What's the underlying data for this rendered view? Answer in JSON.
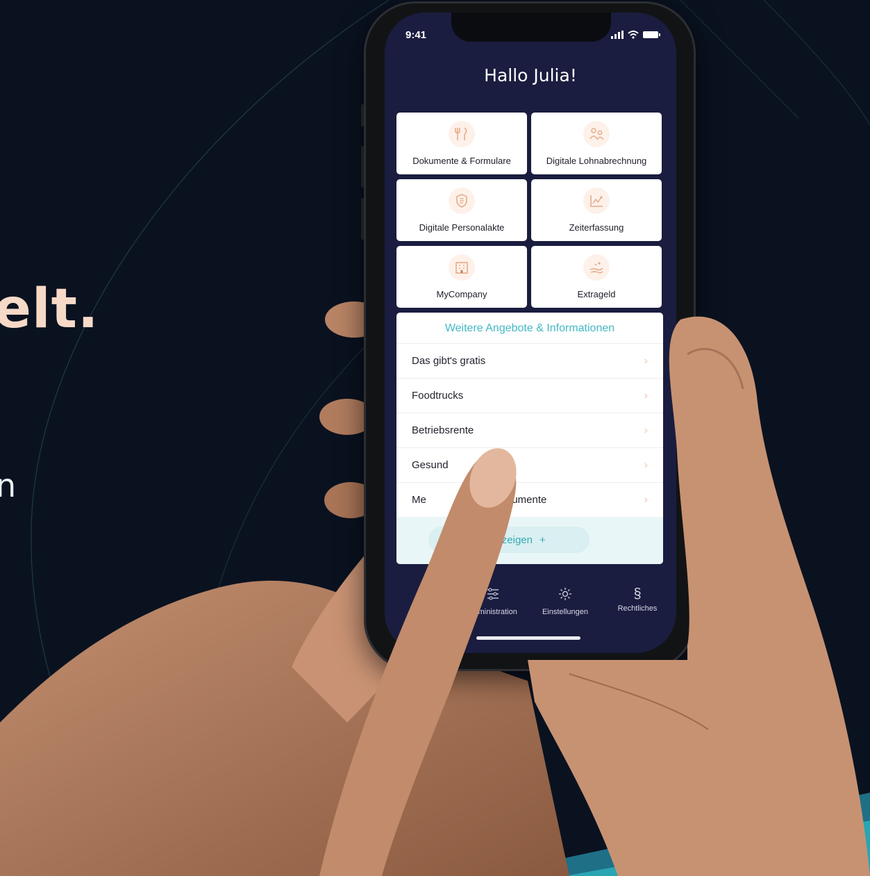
{
  "headline_fragment": "elt.",
  "side_fragment": "n",
  "phone": {
    "status_time": "9:41",
    "greeting": "Hallo Julia!",
    "tiles": [
      {
        "label": "Dokumente & Formulare",
        "icon": "fork-knife-icon"
      },
      {
        "label": "Digitale Lohnabrechnung",
        "icon": "people-icon"
      },
      {
        "label": "Digitale Personalakte",
        "icon": "shield-icon"
      },
      {
        "label": "Zeiterfassung",
        "icon": "chart-icon"
      },
      {
        "label": "MyCompany",
        "icon": "building-icon"
      },
      {
        "label": "Extrageld",
        "icon": "money-hand-icon"
      }
    ],
    "panel": {
      "title": "Weitere Angebote & Informationen",
      "rows": [
        {
          "label": "Das gibt's gratis"
        },
        {
          "label": "Foodtrucks"
        },
        {
          "label": "Betriebsrente"
        },
        {
          "label": "Gesund"
        },
        {
          "label": "Me",
          "suffix": "kumente"
        }
      ],
      "more_label": "ehr anzeigen",
      "more_icon": "+"
    },
    "tabbar": [
      {
        "label": "Administration",
        "icon": "sliders-icon"
      },
      {
        "label": "Einstellungen",
        "icon": "gear-icon"
      },
      {
        "label": "Rechtliches",
        "icon": "section-icon"
      }
    ]
  },
  "colors": {
    "background": "#0a1220",
    "screen": "#1a1d3f",
    "accent_teal": "#43b9c4",
    "accent_peach": "#f6d9c6"
  }
}
